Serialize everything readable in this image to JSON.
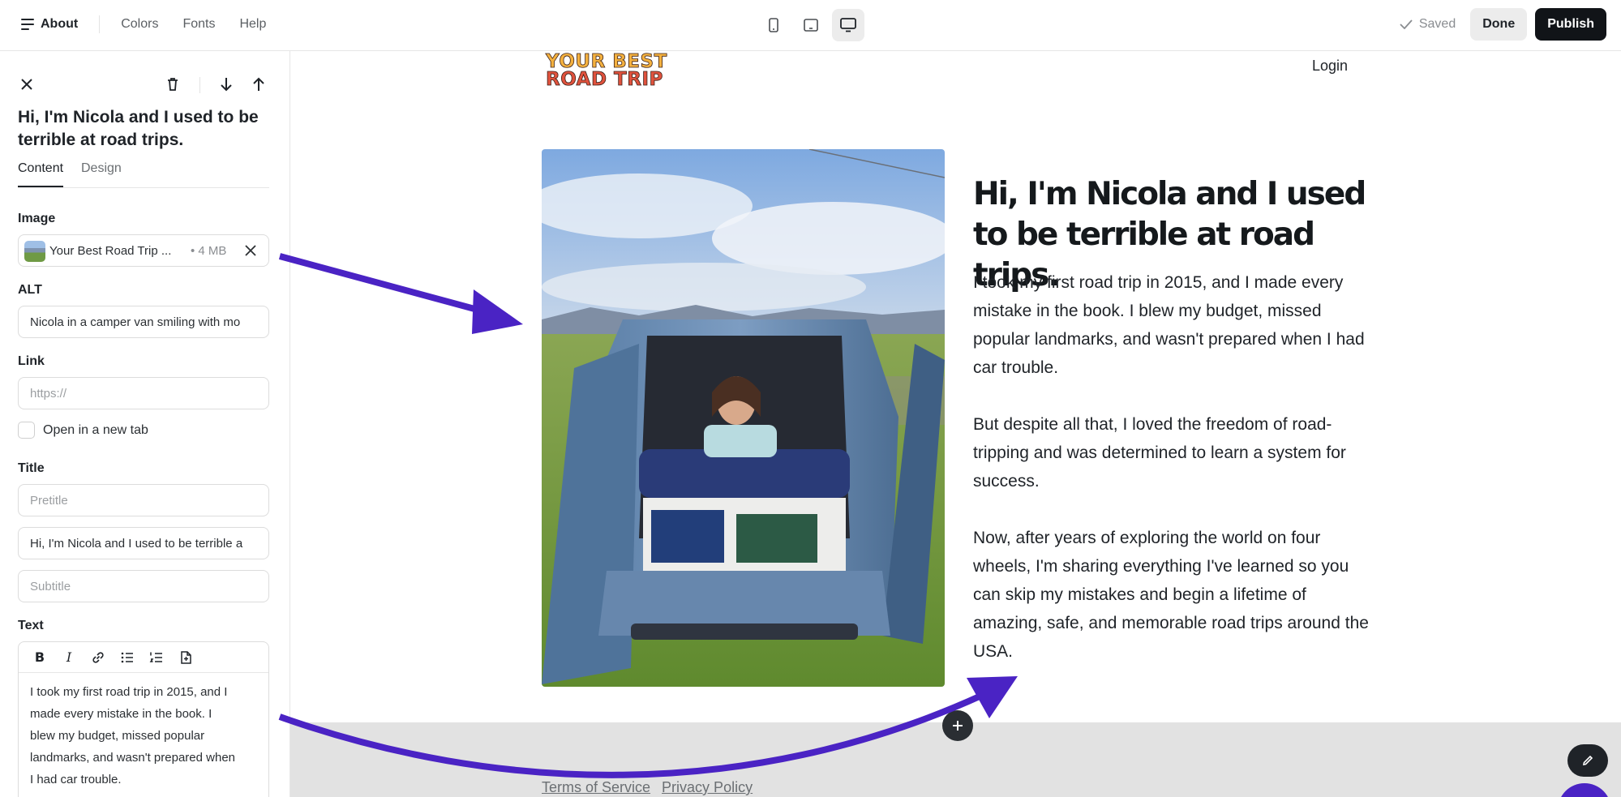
{
  "topbar": {
    "menu_label": "About",
    "nav": [
      "Colors",
      "Fonts",
      "Help"
    ],
    "devices": [
      "phone-icon",
      "tablet-icon",
      "desktop-icon"
    ],
    "active_device": "desktop",
    "saved_label": "Saved",
    "done_label": "Done",
    "publish_label": "Publish"
  },
  "panel": {
    "title": "Hi, I'm Nicola and I used to be terrible at road trips.",
    "tabs": [
      "Content",
      "Design"
    ],
    "active_tab": "Content",
    "image": {
      "label": "Image",
      "file_name": "Your Best Road Trip ...",
      "file_size": "• 4 MB"
    },
    "alt": {
      "label": "ALT",
      "value": "Nicola in a camper van smiling with mo"
    },
    "link": {
      "label": "Link",
      "placeholder": "https://",
      "new_tab_label": "Open in a new tab"
    },
    "title_section": {
      "label": "Title",
      "pretitle_placeholder": "Pretitle",
      "title_value": "Hi, I'm Nicola and I used to be terrible a",
      "subtitle_placeholder": "Subtitle"
    },
    "text": {
      "label": "Text",
      "toolbar": [
        "bold-icon",
        "italic-icon",
        "link-icon",
        "bulleted-list-icon",
        "numbered-list-icon",
        "insert-file-icon"
      ],
      "lines": [
        "I took my first road trip in 2015, and I",
        "made every mistake in the book. I",
        "blew my budget, missed popular",
        "landmarks, and wasn't prepared when",
        "I had car trouble."
      ]
    }
  },
  "canvas": {
    "logo_line1": "YOUR BEST",
    "logo_line2": "ROAD TRIP",
    "login": "Login",
    "hero_title": "Hi, I'm Nicola and I used to be terrible at road trips.",
    "paragraphs": [
      "I took my first road trip in 2015, and I made every mistake in the book. I blew my budget, missed popular landmarks, and wasn't prepared when I had car trouble.",
      "But despite all that, I loved the freedom of road-tripping and was determined to learn a system for success.",
      "Now, after years of exploring the world on four wheels, I'm sharing everything I've learned so you can skip my mistakes and begin a lifetime of amazing, safe, and memorable road trips around the USA."
    ],
    "footer_links": [
      "Terms of Service",
      "Privacy Policy"
    ]
  },
  "colors": {
    "accent": "#4a23c4",
    "publish_bg": "#111418",
    "footer_bg": "#e2e2e2"
  }
}
